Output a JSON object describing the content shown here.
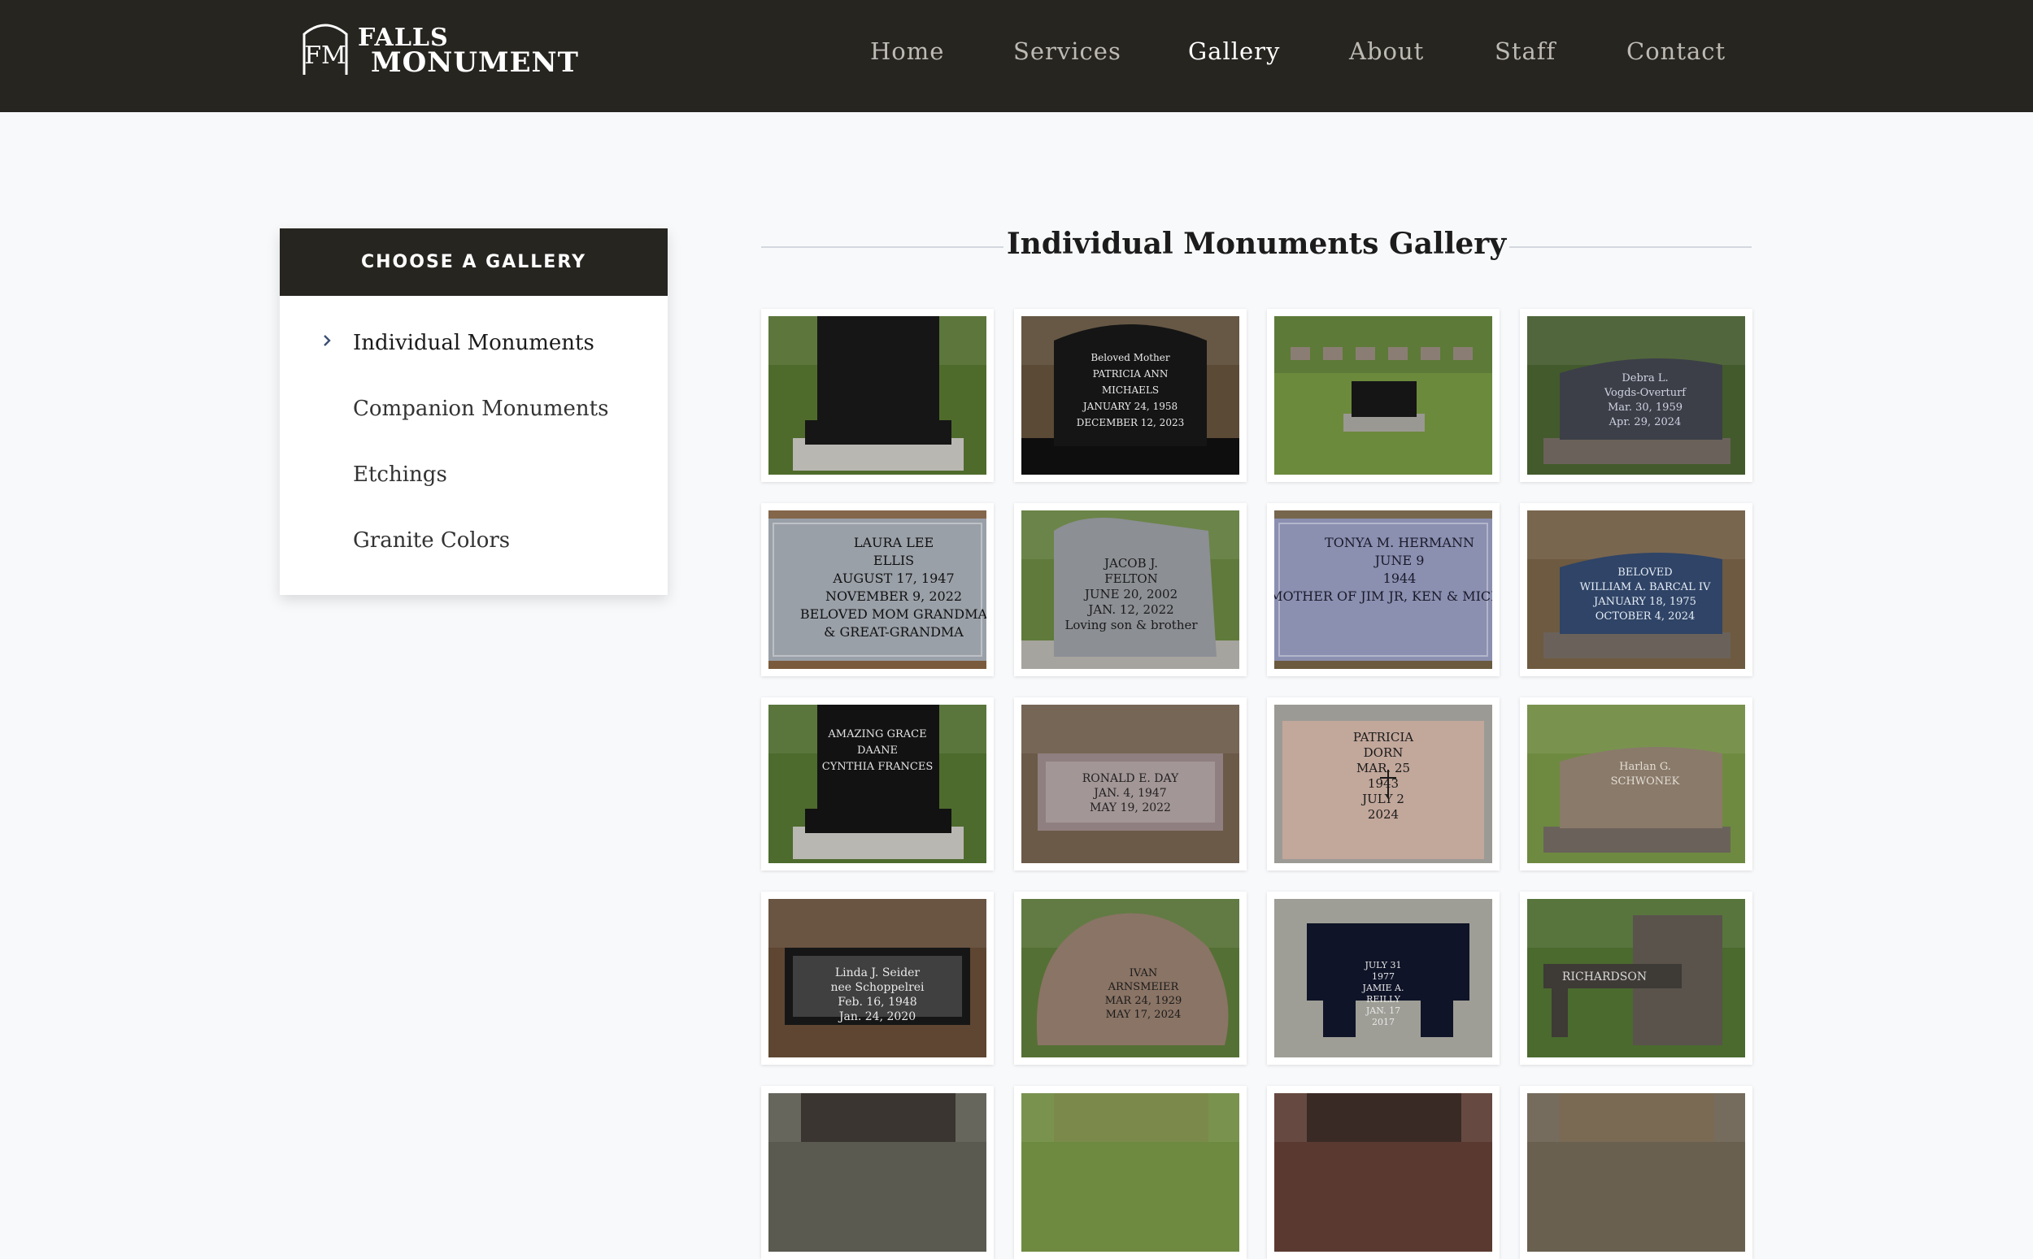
{
  "brand": {
    "line1": "FALLS",
    "line2": "MONUMENT",
    "monogram": "FM"
  },
  "nav": [
    {
      "label": "Home",
      "active": false
    },
    {
      "label": "Services",
      "active": false
    },
    {
      "label": "Gallery",
      "active": true
    },
    {
      "label": "About",
      "active": false
    },
    {
      "label": "Staff",
      "active": false
    },
    {
      "label": "Contact",
      "active": false
    }
  ],
  "sidebar": {
    "heading": "CHOOSE A GALLERY",
    "items": [
      {
        "label": "Individual Monuments",
        "active": true
      },
      {
        "label": "Companion Monuments",
        "active": false
      },
      {
        "label": "Etchings",
        "active": false
      },
      {
        "label": "Granite Colors",
        "active": false
      }
    ]
  },
  "gallery": {
    "title": "Individual Monuments Gallery",
    "photos": [
      {
        "name": "black-tree-headstone",
        "lines": [],
        "stone": "#161616",
        "ground": "#4f6b2c",
        "shape": "upright-tall",
        "ink": "#ddd"
      },
      {
        "name": "michaels-headstone",
        "lines": [
          "Beloved Mother",
          "PATRICIA ANN",
          "MICHAELS",
          "JANUARY 24, 1958",
          "DECEMBER 12, 2023"
        ],
        "stone": "#151515",
        "ground": "#5a4a36",
        "shape": "upright-arched",
        "ink": "#e8e8e8"
      },
      {
        "name": "cemetery-black-headstone",
        "lines": [],
        "stone": "#151515",
        "ground": "#6c8a3c",
        "shape": "small-distant",
        "ink": "#ccc"
      },
      {
        "name": "vogds-overturf-headstone",
        "lines": [
          "Debra L.",
          "Vogds-Overturf",
          "Mar. 30, 1959",
          "Apr. 29, 2024"
        ],
        "stone": "#3c3f48",
        "ground": "#435a2c",
        "shape": "upright-slant",
        "ink": "#cfd3e0"
      },
      {
        "name": "ellis-flat-marker",
        "lines": [
          "LAURA LEE",
          "ELLIS",
          "AUGUST 17, 1947",
          "NOVEMBER 9, 2022",
          "BELOVED MOM GRANDMA",
          "& GREAT-GRANDMA"
        ],
        "stone": "#9aa0a8",
        "ground": "#7a5a3c",
        "shape": "flat-closeup",
        "ink": "#111"
      },
      {
        "name": "felton-headstone",
        "lines": [
          "JACOB J.",
          "FELTON",
          "JUNE 20, 2002",
          "JAN. 12, 2022",
          "Loving son & brother"
        ],
        "stone": "#8c8f94",
        "ground": "#5f7a3a",
        "shape": "rustic-upright",
        "ink": "#1a1a1a"
      },
      {
        "name": "hermann-flat-marker",
        "lines": [
          "TONYA M. HERMANN",
          "JUNE 9",
          "1944",
          "MOTHER OF JIM JR, KEN & MICHAEL"
        ],
        "stone": "#8b8fb0",
        "ground": "#6b5a3e",
        "shape": "flat-closeup",
        "ink": "#1a1a2a"
      },
      {
        "name": "barcal-blue-headstone",
        "lines": [
          "BELOVED",
          "WILLIAM A. BARCAL IV",
          "JANUARY 18, 1975",
          "OCTOBER 4, 2024"
        ],
        "stone": "#2f4466",
        "ground": "#6e5a40",
        "shape": "upright-slant",
        "ink": "#e6ecf6"
      },
      {
        "name": "daane-black-headstone",
        "lines": [
          "AMAZING GRACE",
          "DAANE",
          "CYNTHIA FRANCES"
        ],
        "stone": "#121212",
        "ground": "#4d6b2d",
        "shape": "upright-tall",
        "ink": "#e5e5e5"
      },
      {
        "name": "ronald-day-flat-marker",
        "lines": [
          "RONALD E. DAY",
          "JAN. 4, 1947",
          "MAY 19, 2022"
        ],
        "stone": "#8f7f80",
        "ground": "#6b5a48",
        "shape": "flat-low",
        "ink": "#222"
      },
      {
        "name": "dorn-pink-marker",
        "lines": [
          "PATRICIA",
          "DORN",
          "MAR. 25",
          "1943",
          "JULY 2",
          "2024"
        ],
        "stone": "#c2a79b",
        "ground": "#8c8c88",
        "shape": "bevel",
        "ink": "#1a1a1a"
      },
      {
        "name": "schwonek-headstone",
        "lines": [
          "Harlan G.",
          "SCHWONEK"
        ],
        "stone": "#8a7a6a",
        "ground": "#6e8a40",
        "shape": "upright-slant",
        "ink": "#e2ddd4"
      },
      {
        "name": "seider-black-marker",
        "lines": [
          "Linda J. Seider",
          "nee Schoppelrei",
          "Feb. 16, 1948",
          "Jan. 24, 2020"
        ],
        "stone": "#161616",
        "ground": "#5e4632",
        "shape": "flat-low",
        "ink": "#e8e8e8"
      },
      {
        "name": "arnsmeier-boulder",
        "lines": [
          "IVAN",
          "ARNSMEIER",
          "MAR 24, 1929",
          "MAY 17, 2024"
        ],
        "stone": "#8a7465",
        "ground": "#557035",
        "shape": "boulder",
        "ink": "#1a1a1a"
      },
      {
        "name": "reilly-bench",
        "lines": [
          "JULY 31",
          "1977",
          "JAMIE A.",
          "REILLY",
          "JAN. 17",
          "2017"
        ],
        "stone": "#0f1428",
        "ground": "#9e9e96",
        "shape": "bench",
        "ink": "#e8e8e8"
      },
      {
        "name": "richardson-bench",
        "lines": [
          "RICHARDSON"
        ],
        "stone": "#3e3a36",
        "ground": "#4a6a2e",
        "shape": "bench-pillar",
        "ink": "#d8d8d8"
      },
      {
        "name": "partial-photo-17",
        "lines": [],
        "stone": "#3a3530",
        "ground": "#5a5a50",
        "shape": "partial",
        "ink": "#ccc"
      },
      {
        "name": "partial-photo-18",
        "lines": [],
        "stone": "#7b8a4a",
        "ground": "#6e8a40",
        "shape": "partial",
        "ink": "#ccc"
      },
      {
        "name": "partial-photo-19",
        "lines": [],
        "stone": "#3a2a26",
        "ground": "#5a3a30",
        "shape": "partial",
        "ink": "#ccc"
      },
      {
        "name": "partial-photo-20",
        "lines": [],
        "stone": "#7a6a54",
        "ground": "#6a6050",
        "shape": "partial",
        "ink": "#ccc"
      }
    ]
  },
  "colors": {
    "header_bg": "#272520",
    "nav_text": "#bdbab3",
    "nav_active": "#ffffff",
    "page_bg": "#f8f9fb",
    "chevron": "#3c4f72"
  }
}
